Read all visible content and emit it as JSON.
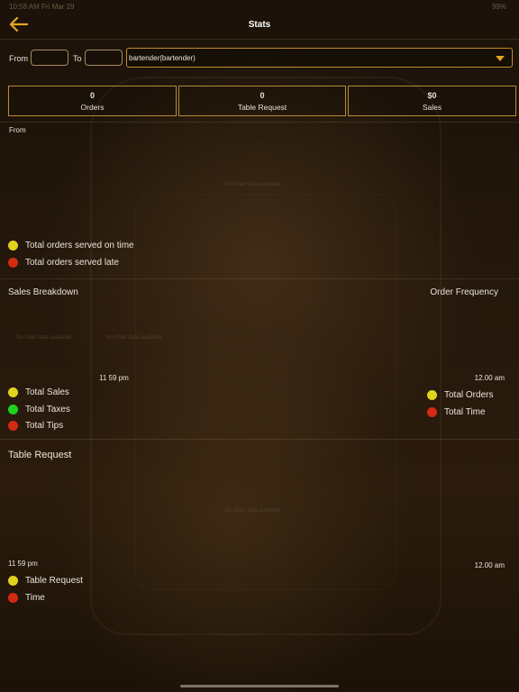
{
  "status_bar": {
    "time": "10:58 AM  Fri Mar 29",
    "battery": "99%"
  },
  "nav": {
    "title": "Stats"
  },
  "filters": {
    "from_label": "From",
    "to_label": "To",
    "from_value": "",
    "to_value": "",
    "user_select": "bartender(bartender)"
  },
  "stats": {
    "orders": {
      "value": "0",
      "label": "Orders"
    },
    "table_request": {
      "value": "0",
      "label": "Table Request"
    },
    "sales": {
      "value": "$0",
      "label": "Sales"
    }
  },
  "served_section": {
    "label": "From",
    "no_data": "No chart data available.",
    "legend": [
      {
        "label": "Total orders served on time",
        "color": "#e2d21c"
      },
      {
        "label": "Total orders served late",
        "color": "#d42a12"
      }
    ]
  },
  "sales_breakdown": {
    "title": "Sales Breakdown",
    "no_data_1": "No chart data available.",
    "no_data_2": "No chart data available.",
    "time_label": "11 59 pm",
    "legend": [
      {
        "label": "Total Sales",
        "color": "#e2d21c"
      },
      {
        "label": "Total Taxes",
        "color": "#1fd21f"
      },
      {
        "label": "Total Tips",
        "color": "#d42a12"
      }
    ]
  },
  "order_frequency": {
    "title": "Order Frequency",
    "time_label": "12.00 am",
    "legend": [
      {
        "label": "Total Orders",
        "color": "#e2d21c"
      },
      {
        "label": "Total Time",
        "color": "#d42a12"
      }
    ]
  },
  "table_request_section": {
    "title": "Table Request",
    "no_data": "No chart data available.",
    "time_start": "11 59 pm",
    "time_end": "12.00 am",
    "legend": [
      {
        "label": "Table Request",
        "color": "#e2d21c"
      },
      {
        "label": "Time",
        "color": "#d42a12"
      }
    ]
  }
}
